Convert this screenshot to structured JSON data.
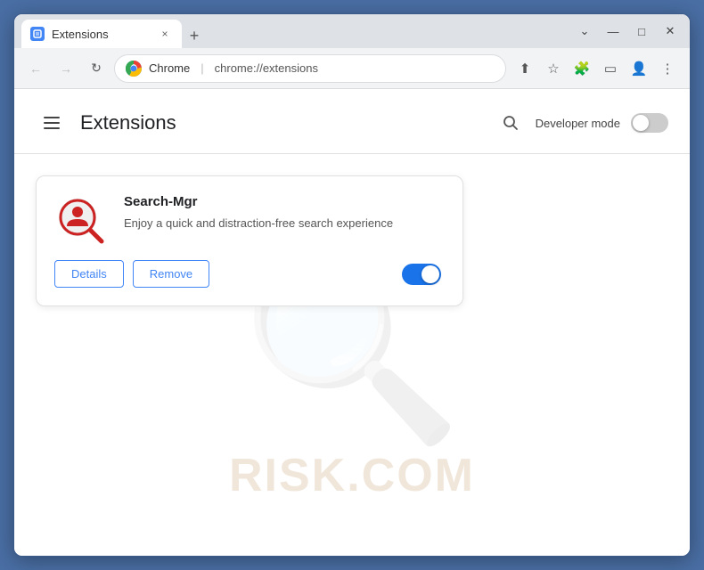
{
  "browser": {
    "tab": {
      "favicon_label": "extensions-favicon",
      "title": "Extensions",
      "close_label": "×",
      "new_tab_label": "+"
    },
    "window_controls": {
      "chevron": "⌄",
      "minimize": "—",
      "maximize": "□",
      "close": "✕"
    },
    "nav": {
      "back_label": "←",
      "forward_label": "→",
      "reload_label": "↻"
    },
    "url_bar": {
      "brand": "Chrome",
      "separator": "|",
      "url": "chrome://extensions"
    },
    "toolbar_icons": {
      "share": "⬆",
      "bookmark": "☆",
      "extensions": "🧩",
      "sidebar": "▭",
      "profile": "👤",
      "menu": "⋮"
    }
  },
  "page": {
    "title": "Extensions",
    "developer_mode_label": "Developer mode",
    "developer_mode_on": false
  },
  "extension": {
    "name": "Search-Mgr",
    "description": "Enjoy a quick and distraction-free search experience",
    "details_button": "Details",
    "remove_button": "Remove",
    "enabled": true
  },
  "watermark": {
    "text": "RISK.COM"
  }
}
